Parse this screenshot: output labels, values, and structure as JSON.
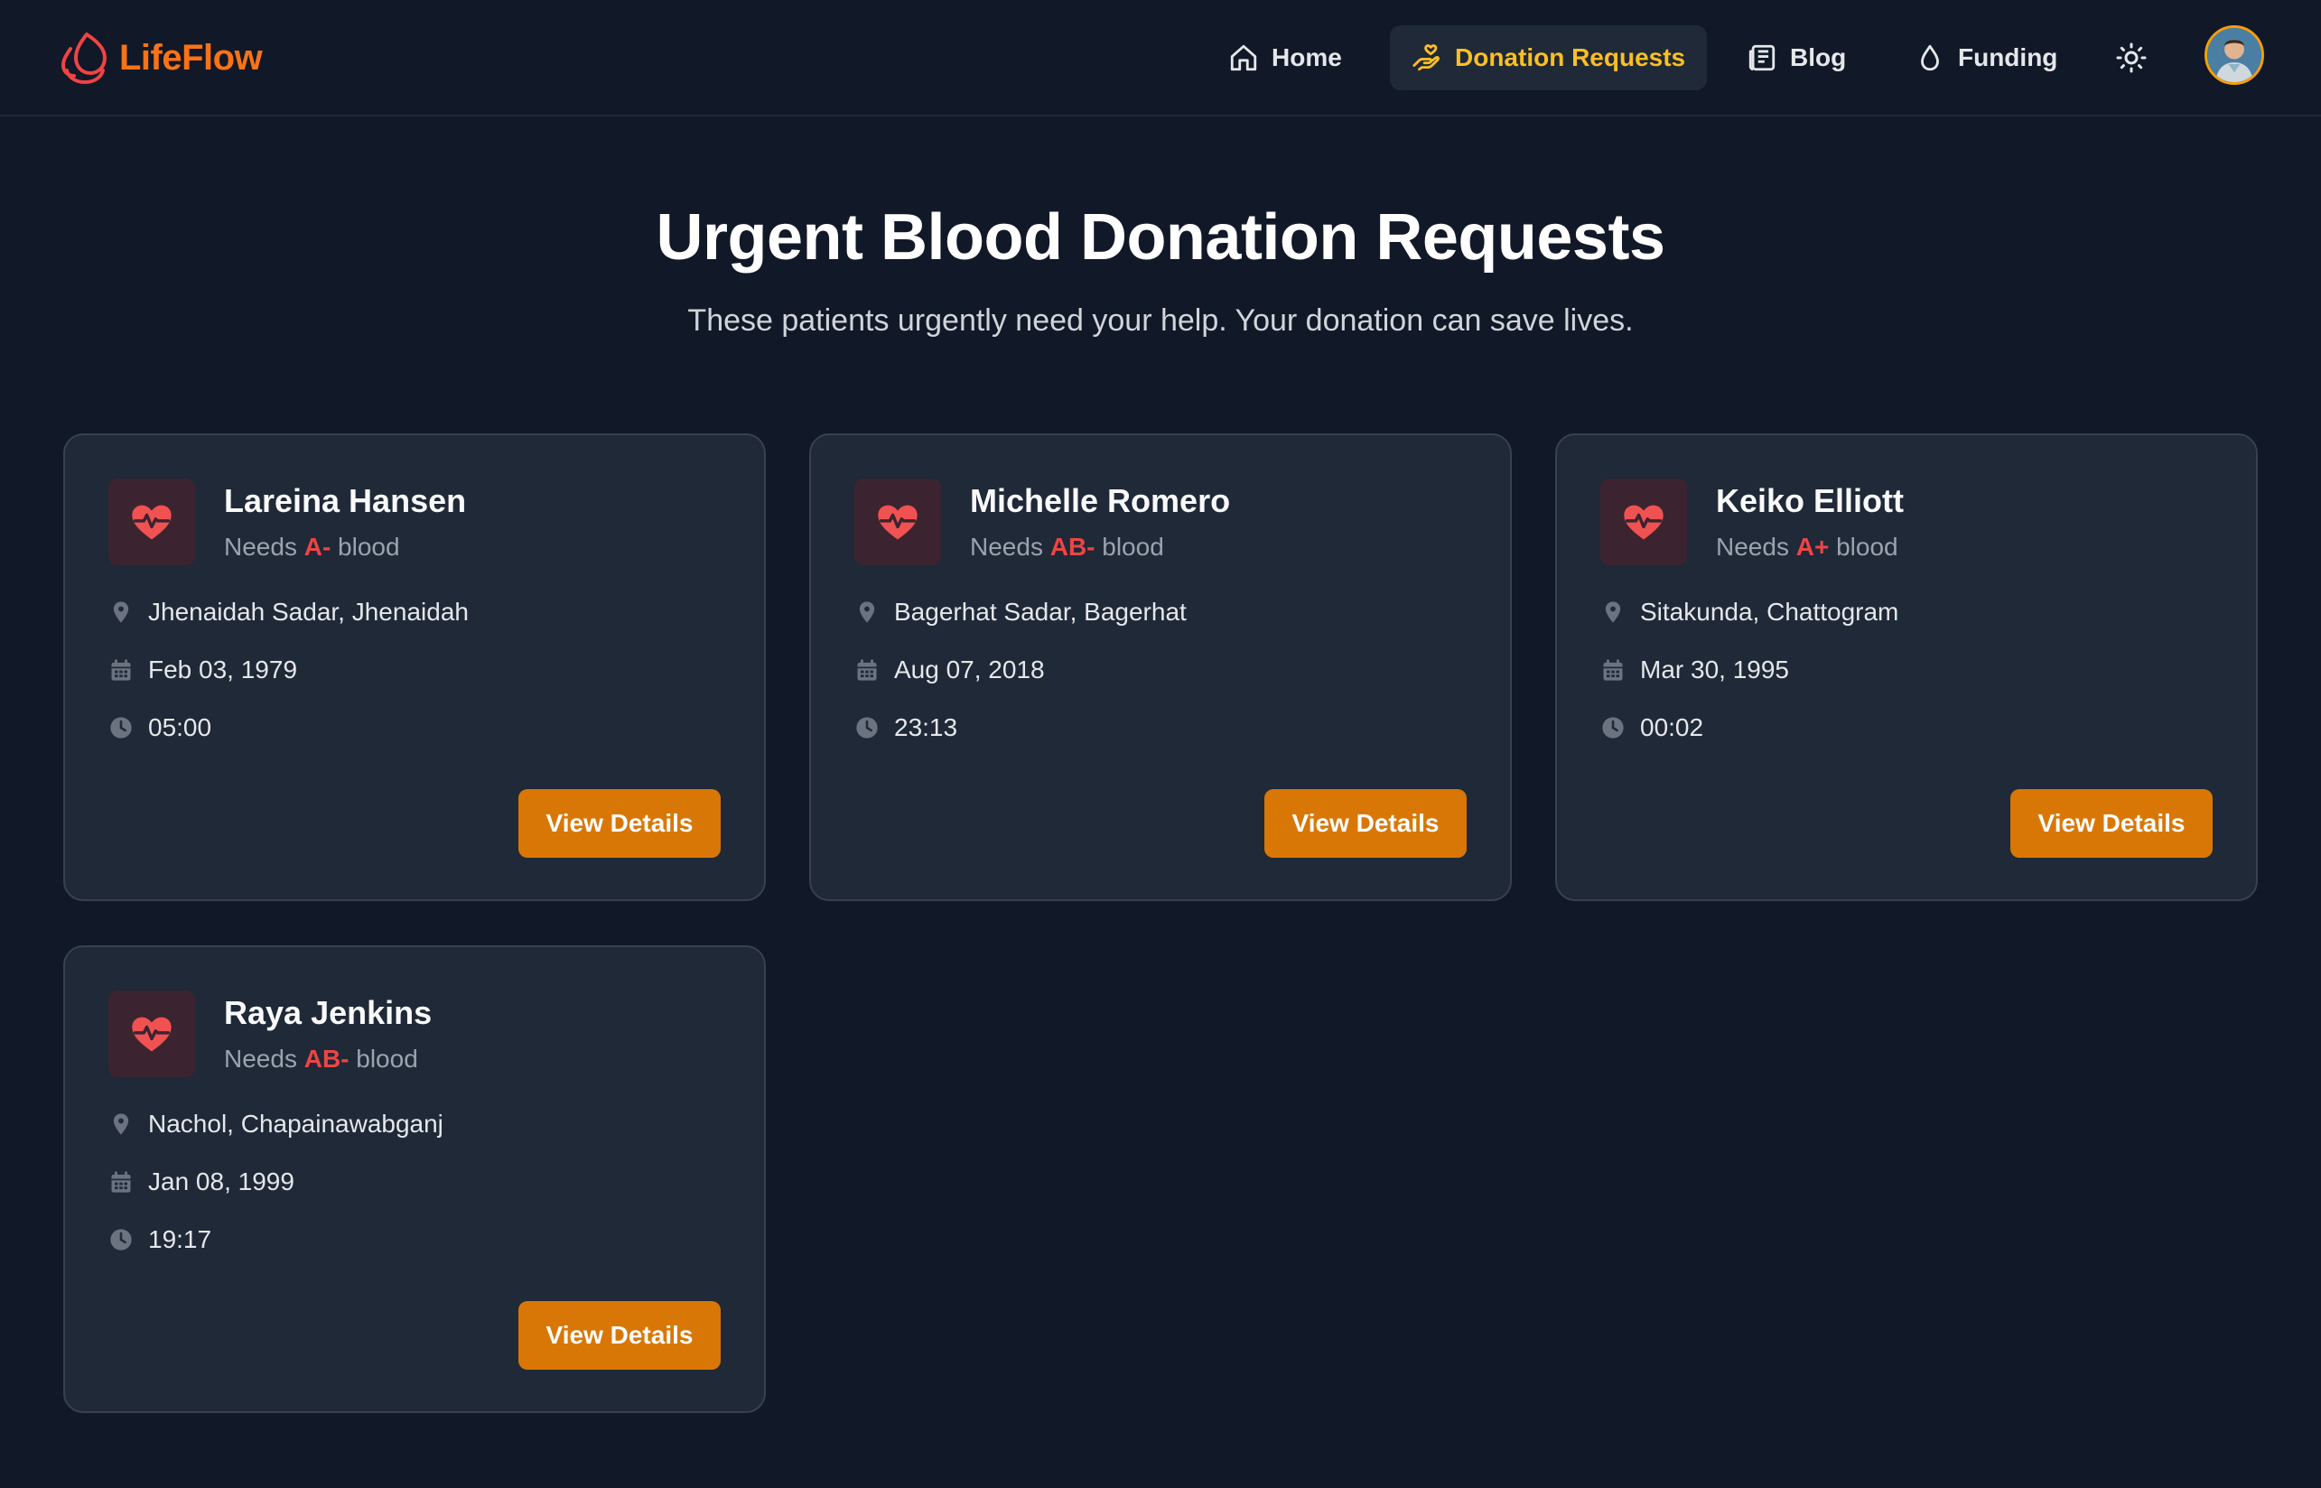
{
  "app": {
    "name": "LifeFlow"
  },
  "nav": {
    "items": [
      {
        "label": "Home",
        "icon": "home-icon"
      },
      {
        "label": "Donation Requests",
        "icon": "hand-heart-icon",
        "active": true
      },
      {
        "label": "Blog",
        "icon": "newspaper-icon"
      },
      {
        "label": "Funding",
        "icon": "droplet-icon"
      }
    ],
    "theme_icon": "sun-icon",
    "avatar_icon": "user-avatar"
  },
  "hero": {
    "title": "Urgent Blood Donation Requests",
    "subtitle": "These patients urgently need your help. Your donation can save lives."
  },
  "cards": [
    {
      "name": "Lareina Hansen",
      "needs_prefix": "Needs",
      "blood": "A-",
      "needs_suffix": "blood",
      "location": "Jhenaidah Sadar, Jhenaidah",
      "date": "Feb 03, 1979",
      "time": "05:00",
      "button": "View Details"
    },
    {
      "name": "Michelle Romero",
      "needs_prefix": "Needs",
      "blood": "AB-",
      "needs_suffix": "blood",
      "location": "Bagerhat Sadar, Bagerhat",
      "date": "Aug 07, 2018",
      "time": "23:13",
      "button": "View Details"
    },
    {
      "name": "Keiko Elliott",
      "needs_prefix": "Needs",
      "blood": "A+",
      "needs_suffix": "blood",
      "location": "Sitakunda, Chattogram",
      "date": "Mar 30, 1995",
      "time": "00:02",
      "button": "View Details"
    },
    {
      "name": "Raya Jenkins",
      "needs_prefix": "Needs",
      "blood": "AB-",
      "needs_suffix": "blood",
      "location": "Nachol, Chapainawabganj",
      "date": "Jan 08, 1999",
      "time": "19:17",
      "button": "View Details"
    }
  ],
  "colors": {
    "background": "#111827",
    "card": "#1f2937",
    "accent": "#f97316",
    "button": "#d97706",
    "active_nav": "#fbbf24",
    "blood_type": "#ef4444"
  }
}
